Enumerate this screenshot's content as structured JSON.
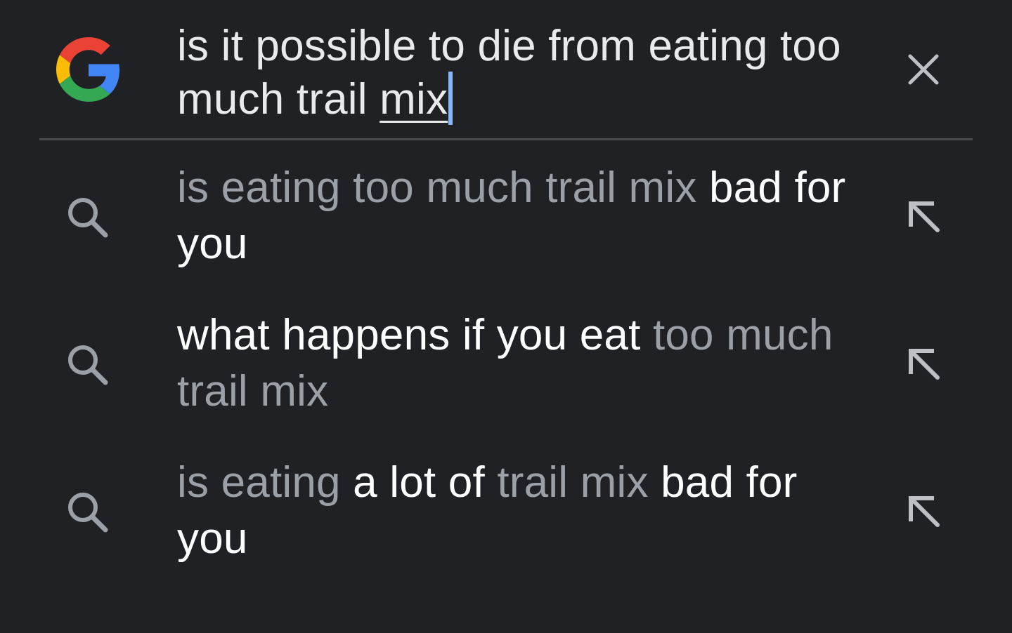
{
  "search": {
    "query_main": "is it possible to die from eating too much trail ",
    "query_last_word": "mix"
  },
  "icons": {
    "logo": "google-g-logo",
    "clear": "close-icon",
    "suggestion": "search-icon",
    "fill": "arrow-up-left-icon"
  },
  "colors": {
    "background": "#202124",
    "text_primary": "#ffffff",
    "text_dim": "#9aa0a6",
    "caret": "#8ab4f8",
    "icon": "#9aa0a6"
  },
  "suggestions": [
    {
      "segments": [
        {
          "text": "is eating too much trail mix ",
          "style": "dim"
        },
        {
          "text": "bad for you",
          "style": "bold"
        }
      ]
    },
    {
      "segments": [
        {
          "text": "what happens if you eat ",
          "style": "bold"
        },
        {
          "text": "too much trail mix",
          "style": "dim"
        }
      ]
    },
    {
      "segments": [
        {
          "text": "is eating ",
          "style": "dim"
        },
        {
          "text": "a lot of ",
          "style": "bold"
        },
        {
          "text": "trail mix ",
          "style": "dim"
        },
        {
          "text": "bad for you",
          "style": "bold"
        }
      ]
    }
  ]
}
